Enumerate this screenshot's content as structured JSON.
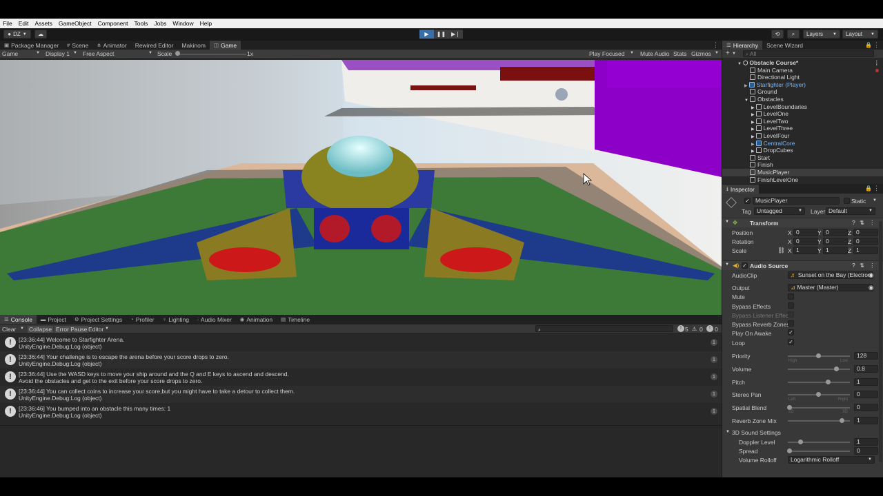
{
  "menu": [
    "File",
    "Edit",
    "Assets",
    "GameObject",
    "Component",
    "Tools",
    "Jobs",
    "Window",
    "Help"
  ],
  "toolbar": {
    "account": "DZ",
    "layers": "Layers",
    "layout": "Layout"
  },
  "main_tabs": [
    "Package Manager",
    "Scene",
    "Animator",
    "Rewired Editor",
    "Makinom",
    "Game"
  ],
  "game_bar": {
    "mode": "Game",
    "display": "Display 1",
    "aspect": "Free Aspect",
    "scale_label": "Scale",
    "scale_value": "1x",
    "play_focused": "Play Focused",
    "mute": "Mute Audio",
    "stats": "Stats",
    "gizmos": "Gizmos"
  },
  "console_tabs": [
    "Console",
    "Project",
    "Project Settings",
    "Profiler",
    "Lighting",
    "Audio Mixer",
    "Animation",
    "Timeline"
  ],
  "console_toolbar": {
    "clear": "Clear",
    "collapse": "Collapse",
    "error_pause": "Error Pause",
    "editor": "Editor",
    "warn_count": "5",
    "error_count": "0",
    "info_count": "0"
  },
  "logs": [
    {
      "line1": "[23:36:44] Welcome to Starfighter Arena.",
      "line2": "UnityEngine.Debug:Log (object)",
      "count": "1"
    },
    {
      "line1": "[23:36:44] Your challenge is to escape the arena before your score drops to zero.",
      "line2": "UnityEngine.Debug:Log (object)",
      "count": "1"
    },
    {
      "line1": "[23:36:44] Use the WASD keys to move your ship around and the Q and E keys to ascend and descend.",
      "line2": "Avoid the obstacles and get to the exit before your score drops to zero.",
      "count": "1"
    },
    {
      "line1": "[23:36:44] You can collect coins to increase your score,but you might have to take a detour to collect them.",
      "line2": "UnityEngine.Debug:Log (object)",
      "count": "1"
    },
    {
      "line1": "[23:36:46] You bumped into an obstacle this many times: 1",
      "line2": "UnityEngine.Debug:Log (object)",
      "count": "1"
    }
  ],
  "hierarchy_tabs": [
    "Hierarchy",
    "Scene Wizard"
  ],
  "hierarchy_search": "All",
  "hierarchy": [
    "Obstacle Course*",
    "Main Camera",
    "Directional Light",
    "Starfighter (Player)",
    "Ground",
    "Obstacles",
    "LevelBoundaries",
    "LevelOne",
    "LevelTwo",
    "LevelThree",
    "LevelFour",
    "CentralCore",
    "DropCubes",
    "Start",
    "Finish",
    "MusicPlayer",
    "FinishLevelOne"
  ],
  "inspector": {
    "tab": "Inspector",
    "object_name": "MusicPlayer",
    "static": "Static",
    "tag_label": "Tag",
    "tag": "Untagged",
    "layer_label": "Layer",
    "layer": "Default",
    "transform": {
      "title": "Transform",
      "position": "Position",
      "rotation": "Rotation",
      "scale": "Scale",
      "px": "0",
      "py": "0",
      "pz": "0",
      "rx": "0",
      "ry": "0",
      "rz": "0",
      "sx": "1",
      "sy": "1",
      "sz": "1",
      "x": "X",
      "y": "Y",
      "z": "Z"
    },
    "audio": {
      "title": "Audio Source",
      "audioclip_label": "AudioClip",
      "audioclip": "Sunset on the Bay (Electroni",
      "output_label": "Output",
      "output": "Master (Master)",
      "mute": "Mute",
      "bypass_effects": "Bypass Effects",
      "bypass_listener": "Bypass Listener Effec",
      "bypass_reverb": "Bypass Reverb Zones",
      "play_on_awake": "Play On Awake",
      "loop": "Loop",
      "priority_label": "Priority",
      "priority": "128",
      "high": "High",
      "low": "Low",
      "volume_label": "Volume",
      "volume": "0.8",
      "pitch_label": "Pitch",
      "pitch": "1",
      "stereo_label": "Stereo Pan",
      "stereo": "0",
      "left": "Left",
      "right": "Right",
      "spatial_label": "Spatial Blend",
      "spatial": "0",
      "twod": "2D",
      "threed": "3D",
      "reverb_label": "Reverb Zone Mix",
      "reverb": "1",
      "sound3d": "3D Sound Settings",
      "doppler_label": "Doppler Level",
      "doppler": "1",
      "spread_label": "Spread",
      "spread": "0",
      "rolloff_label": "Volume Rolloff",
      "rolloff": "Logarithmic Rolloff"
    }
  },
  "colors": {
    "accent": "#3a6ea5",
    "panel": "#383838",
    "dark": "#282828"
  }
}
